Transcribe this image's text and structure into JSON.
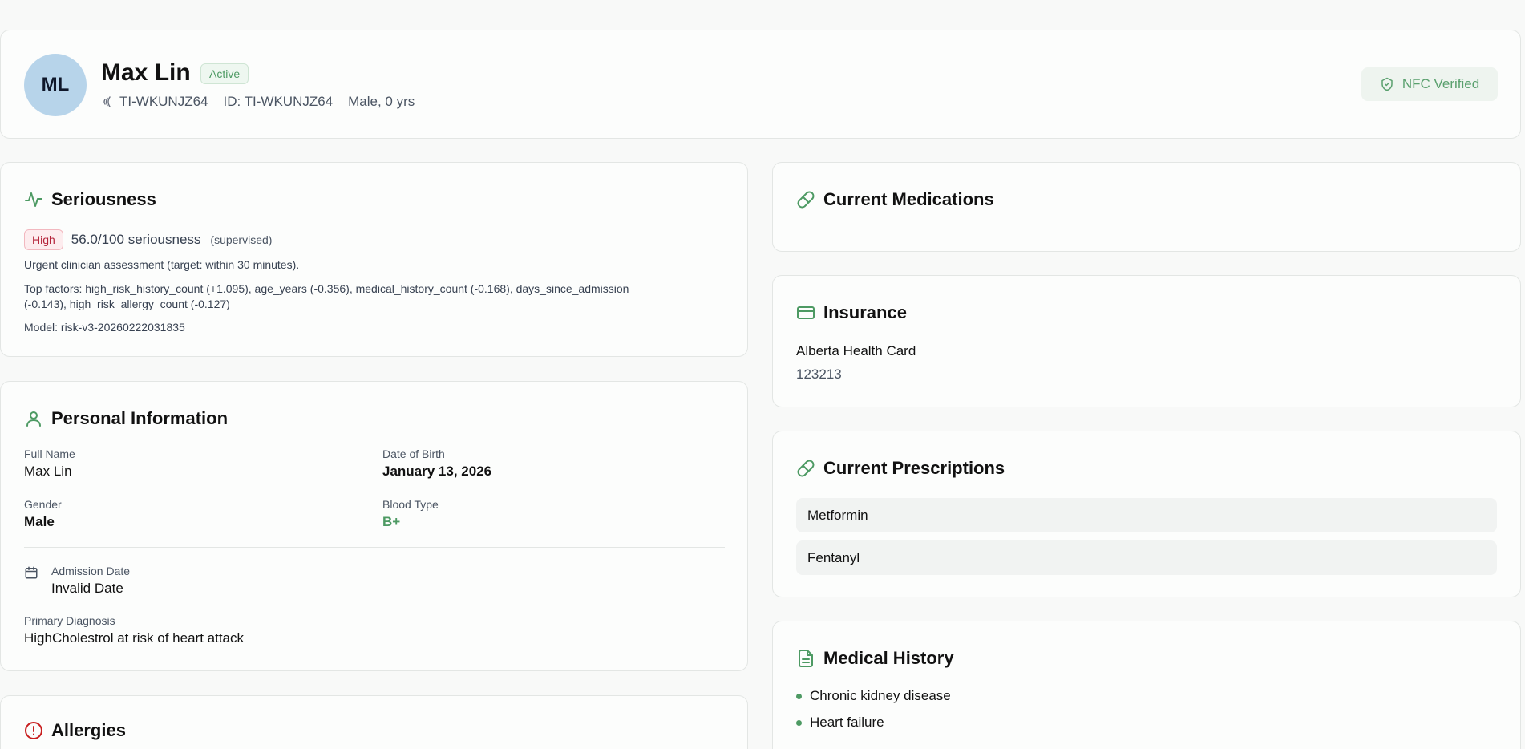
{
  "patient": {
    "initials": "ML",
    "name": "Max Lin",
    "status": "Active",
    "nfc_tag": "TI-WKUNJZ64",
    "id_text": "ID: TI-WKUNJZ64",
    "demographics": "Male, 0 yrs",
    "nfc_verified": "NFC Verified"
  },
  "seriousness": {
    "title": "Seriousness",
    "level": "High",
    "score": "56.0/100 seriousness",
    "mode": "(supervised)",
    "recommendation": "Urgent clinician assessment (target: within 30 minutes).",
    "factors_line1": "Top factors: high_risk_history_count (+1.095), age_years (-0.356), medical_history_count (-0.168), days_since_admission",
    "factors_line2": "(-0.143), high_risk_allergy_count (-0.127)",
    "model": "Model: risk-v3-20260222031835"
  },
  "personal": {
    "title": "Personal Information",
    "full_name_label": "Full Name",
    "full_name": "Max Lin",
    "dob_label": "Date of Birth",
    "dob": "January 13, 2026",
    "gender_label": "Gender",
    "gender": "Male",
    "blood_label": "Blood Type",
    "blood": "B+",
    "admission_label": "Admission Date",
    "admission": "Invalid Date",
    "diagnosis_label": "Primary Diagnosis",
    "diagnosis": "HighCholestrol at risk of heart attack"
  },
  "allergies": {
    "title": "Allergies"
  },
  "medications": {
    "title": "Current Medications"
  },
  "insurance": {
    "title": "Insurance",
    "provider": "Alberta Health Card",
    "number": "123213"
  },
  "prescriptions": {
    "title": "Current Prescriptions",
    "items": [
      "Metformin",
      "Fentanyl"
    ]
  },
  "history": {
    "title": "Medical History",
    "items": [
      "Chronic kidney disease",
      "Heart failure"
    ]
  },
  "colors": {
    "accent_green": "#4d9a63",
    "alert_red": "#c81e1e",
    "avatar_bg": "#b7d4ea"
  },
  "icons": [
    "nfc-wave-icon",
    "shield-check-icon",
    "activity-icon",
    "user-icon",
    "calendar-icon",
    "alert-circle-icon",
    "pill-icon",
    "credit-card-icon",
    "file-text-icon"
  ]
}
